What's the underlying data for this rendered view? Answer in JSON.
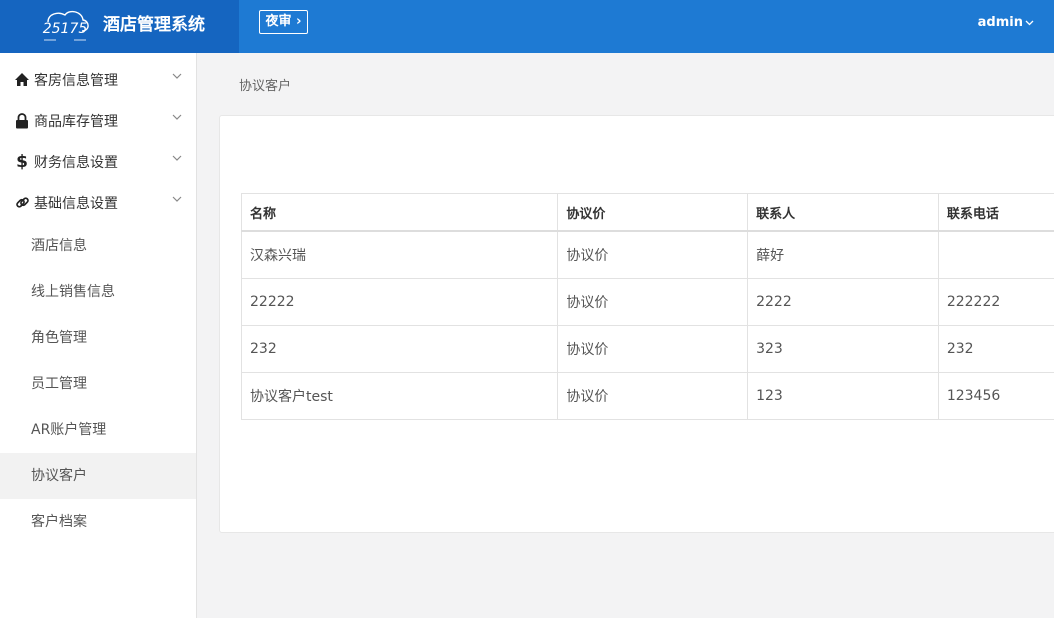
{
  "header": {
    "logo_text": "25175",
    "title": "酒店管理系统",
    "night_audit_label": "夜审",
    "user": "admin",
    "accent": "#1e7ad3"
  },
  "sidebar": {
    "groups": [
      {
        "label": "客房信息管理",
        "icon": "home-icon"
      },
      {
        "label": "商品库存管理",
        "icon": "lock-icon"
      },
      {
        "label": "财务信息设置",
        "icon": "dollar-icon"
      },
      {
        "label": "基础信息设置",
        "icon": "link-icon"
      }
    ],
    "sub_items": [
      {
        "label": "酒店信息"
      },
      {
        "label": "线上销售信息"
      },
      {
        "label": "角色管理"
      },
      {
        "label": "员工管理"
      },
      {
        "label": "AR账户管理"
      },
      {
        "label": "协议客户",
        "active": true
      },
      {
        "label": "客户档案"
      }
    ]
  },
  "breadcrumb": "协议客户",
  "table": {
    "columns": [
      "名称",
      "协议价",
      "联系人",
      "联系电话"
    ],
    "rows": [
      [
        "汉森兴瑞",
        "协议价",
        "薛好",
        ""
      ],
      [
        "22222",
        "协议价",
        "2222",
        "222222"
      ],
      [
        "232",
        "协议价",
        "323",
        "232"
      ],
      [
        "协议客户test",
        "协议价",
        "123",
        "123456"
      ]
    ]
  }
}
